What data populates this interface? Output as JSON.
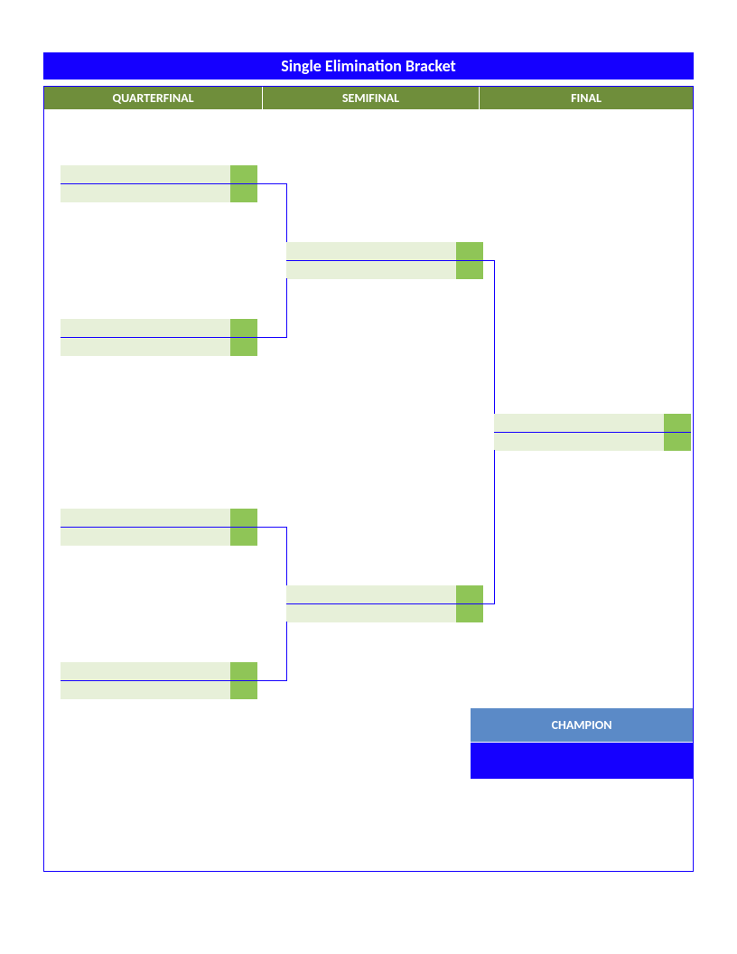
{
  "title": "Single Elimination Bracket",
  "rounds": {
    "r1": "QUARTERFINAL",
    "r2": "SEMIFINAL",
    "r3": "FINAL"
  },
  "champion_label": "CHAMPION",
  "matches": {
    "qf1": {
      "name1": "",
      "score1": "",
      "name2": "",
      "score2": ""
    },
    "qf2": {
      "name1": "",
      "score1": "",
      "name2": "",
      "score2": ""
    },
    "qf3": {
      "name1": "",
      "score1": "",
      "name2": "",
      "score2": ""
    },
    "qf4": {
      "name1": "",
      "score1": "",
      "name2": "",
      "score2": ""
    },
    "sf1": {
      "name1": "",
      "score1": "",
      "name2": "",
      "score2": ""
    },
    "sf2": {
      "name1": "",
      "score1": "",
      "name2": "",
      "score2": ""
    },
    "f1": {
      "name1": "",
      "score1": "",
      "name2": "",
      "score2": ""
    }
  },
  "champion_name": ""
}
